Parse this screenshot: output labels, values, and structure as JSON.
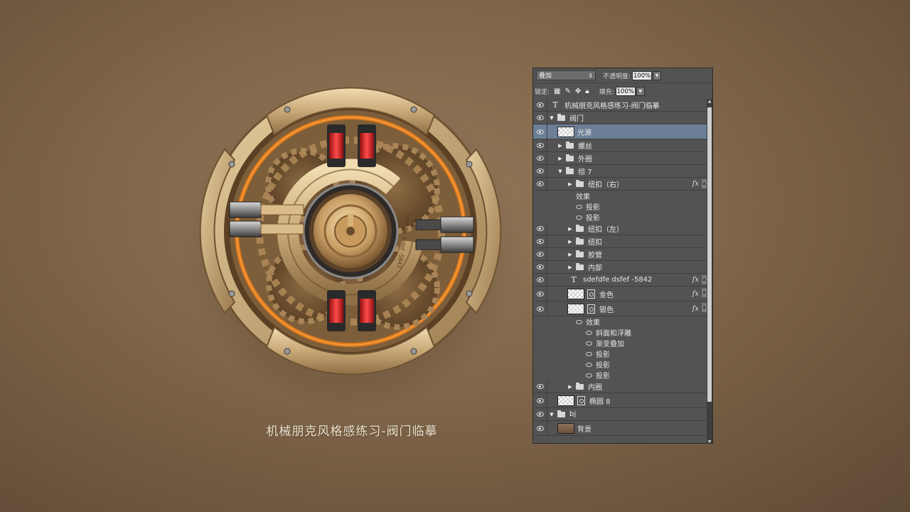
{
  "caption": "机械朋克风格感练习-阀门临摹",
  "valve_text": "sdefdfe dsfef -5842",
  "panel": {
    "blend_mode": "叠加",
    "opacity_label": "不透明度:",
    "opacity_value": "100%",
    "lock_label": "锁定:",
    "fill_label": "填充:",
    "fill_value": "100%"
  },
  "layers": [
    {
      "id": "text1",
      "name": "机械朋克风格感练习-阀门临摹",
      "kind": "text",
      "indent": 0,
      "visible": true
    },
    {
      "id": "grp_valve",
      "name": "阀门",
      "kind": "group-open",
      "indent": 0,
      "visible": true
    },
    {
      "id": "light",
      "name": "光源",
      "kind": "thumb",
      "indent": 1,
      "visible": true,
      "selected": true
    },
    {
      "id": "screw",
      "name": "螺丝",
      "kind": "group",
      "indent": 1,
      "visible": true
    },
    {
      "id": "outer",
      "name": "外圈",
      "kind": "group",
      "indent": 1,
      "visible": true
    },
    {
      "id": "grp7",
      "name": "组 7",
      "kind": "group-open",
      "indent": 1,
      "visible": true
    },
    {
      "id": "btn_r",
      "name": "纽扣（右）",
      "kind": "group",
      "indent": 2,
      "visible": true,
      "fx": true
    },
    {
      "id": "btn_r_eff",
      "name": "效果",
      "kind": "effects",
      "indent": 3
    },
    {
      "id": "btn_r_e1",
      "name": "投影",
      "kind": "effect",
      "indent": 3
    },
    {
      "id": "btn_r_e2",
      "name": "投影",
      "kind": "effect",
      "indent": 3
    },
    {
      "id": "btn_l",
      "name": "纽扣（左）",
      "kind": "group",
      "indent": 2,
      "visible": true
    },
    {
      "id": "btn",
      "name": "纽扣",
      "kind": "group",
      "indent": 2,
      "visible": true
    },
    {
      "id": "hose",
      "name": "胶管",
      "kind": "group",
      "indent": 2,
      "visible": true
    },
    {
      "id": "inner",
      "name": "内部",
      "kind": "group",
      "indent": 2,
      "visible": true
    },
    {
      "id": "text2",
      "name": "sdefdfe dsfef -5842",
      "kind": "text",
      "indent": 2,
      "visible": true,
      "fx": true
    },
    {
      "id": "gold",
      "name": "金色",
      "kind": "thumbmask",
      "indent": 2,
      "visible": true,
      "fx": true
    },
    {
      "id": "silver",
      "name": "银色",
      "kind": "thumbmask",
      "indent": 2,
      "visible": true,
      "fx": true
    },
    {
      "id": "silver_eff",
      "name": "效果",
      "kind": "effects",
      "indent": 3
    },
    {
      "id": "silver_e1",
      "name": "斜面和浮雕",
      "kind": "effect",
      "indent": 4
    },
    {
      "id": "silver_e2",
      "name": "渐变叠加",
      "kind": "effect",
      "indent": 4
    },
    {
      "id": "silver_e3",
      "name": "投影",
      "kind": "effect",
      "indent": 4
    },
    {
      "id": "silver_e4",
      "name": "投影",
      "kind": "effect",
      "indent": 4
    },
    {
      "id": "silver_e5",
      "name": "投影",
      "kind": "effect",
      "indent": 4
    },
    {
      "id": "innerring",
      "name": "内圈",
      "kind": "group",
      "indent": 2,
      "visible": true
    },
    {
      "id": "ellipse8",
      "name": "椭圆 8",
      "kind": "thumbmask",
      "indent": 1,
      "visible": true
    },
    {
      "id": "bj",
      "name": "bj",
      "kind": "group-open",
      "indent": 0,
      "visible": true
    },
    {
      "id": "bg",
      "name": "背景",
      "kind": "thumb-brown",
      "indent": 1,
      "visible": true
    }
  ],
  "colors": {
    "panel_bg": "#535353",
    "selected_row": "#6d7f97",
    "gold": "#c9a877",
    "orange_tube": "#e07a1a",
    "red_coil": "#d42a2a"
  }
}
